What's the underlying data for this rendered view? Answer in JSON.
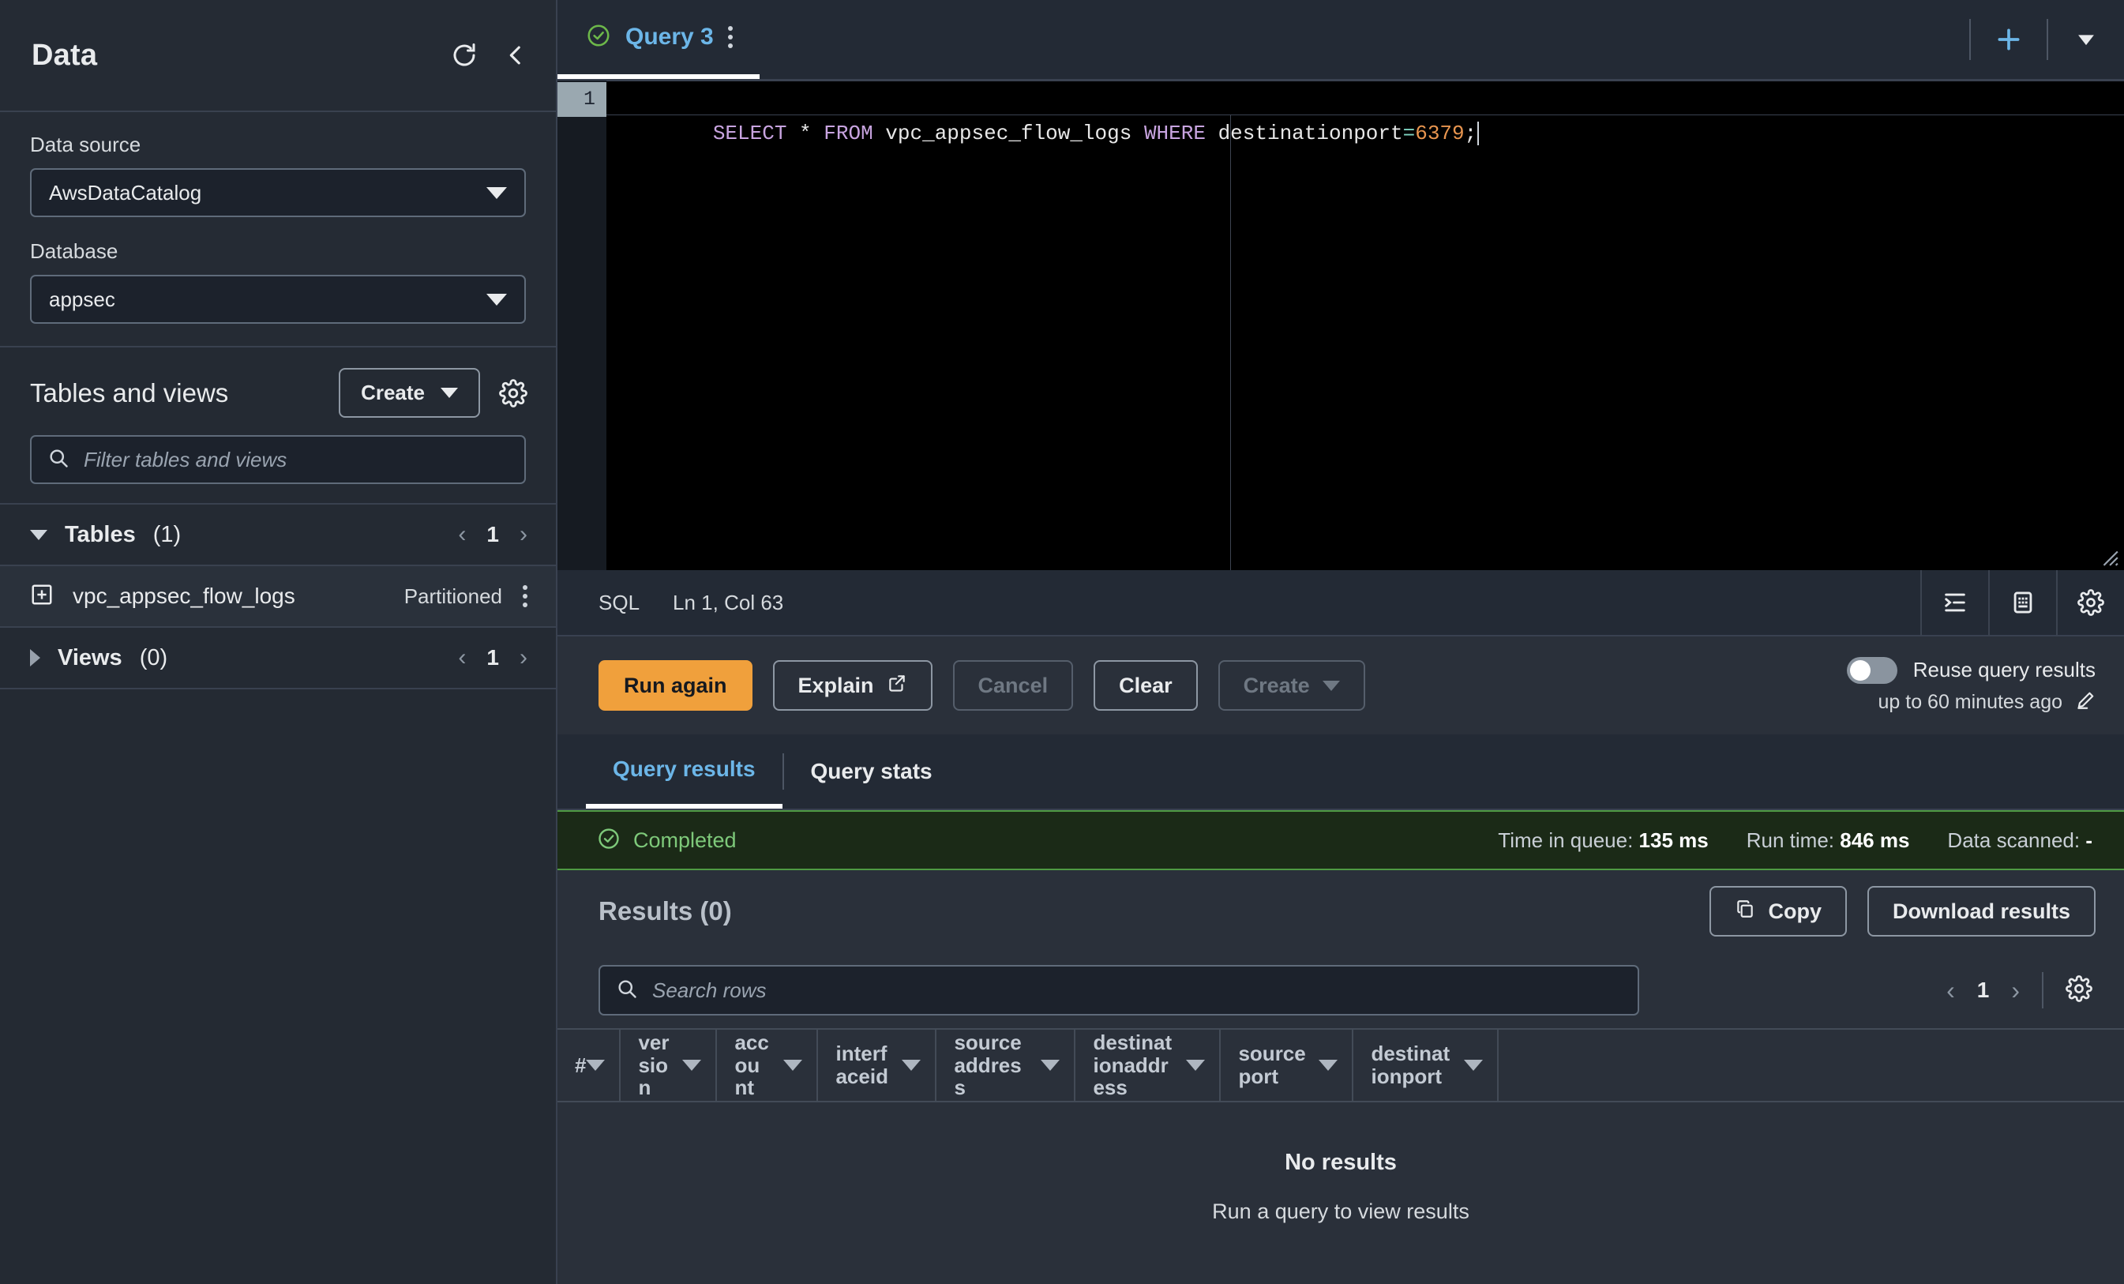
{
  "sidebar": {
    "title": "Data",
    "refresh_icon": "refresh-icon",
    "collapse_icon": "chevron-left-icon",
    "data_source_label": "Data source",
    "data_source_value": "AwsDataCatalog",
    "database_label": "Database",
    "database_value": "appsec",
    "tables_views_title": "Tables and views",
    "create_label": "Create",
    "settings_icon": "gear-icon",
    "filter_placeholder": "Filter tables and views",
    "groups": [
      {
        "name": "Tables",
        "count": "(1)",
        "page": "1",
        "expanded": true
      },
      {
        "name": "Views",
        "count": "(0)",
        "page": "1",
        "expanded": false
      }
    ],
    "table_item": {
      "name": "vpc_appsec_flow_logs",
      "badge": "Partitioned"
    }
  },
  "tabbar": {
    "tab_label": "Query 3",
    "status_icon": "check-circle-icon",
    "kebab_icon": "more-vertical-icon",
    "add_icon": "plus-icon",
    "dropdown_icon": "chevron-down-icon"
  },
  "editor": {
    "line_number": "1",
    "sql_tokens": [
      {
        "t": "SELECT",
        "c": "kw"
      },
      {
        "t": " * ",
        "c": "id"
      },
      {
        "t": "FROM",
        "c": "kw"
      },
      {
        "t": " vpc_appsec_flow_logs ",
        "c": "id"
      },
      {
        "t": "WHERE",
        "c": "kw"
      },
      {
        "t": " destinationport",
        "c": "id"
      },
      {
        "t": "=",
        "c": "op"
      },
      {
        "t": "6379",
        "c": "num"
      },
      {
        "t": ";",
        "c": "id"
      }
    ],
    "sql_text": "SELECT * FROM vpc_appsec_flow_logs WHERE destinationport=6379;"
  },
  "sqlbar": {
    "lang": "SQL",
    "cursor_pos": "Ln 1, Col 63",
    "format_icon": "format-indent-icon",
    "keyboard_icon": "keyboard-icon",
    "settings_icon": "gear-icon"
  },
  "actions": {
    "run_again": "Run again",
    "explain": "Explain",
    "explain_icon": "external-link-icon",
    "cancel": "Cancel",
    "clear": "Clear",
    "create": "Create",
    "reuse_label": "Reuse query results",
    "reuse_sub": "up to 60 minutes ago",
    "edit_icon": "pencil-icon",
    "reuse_on": false
  },
  "result_tabs": [
    {
      "label": "Query results",
      "active": true
    },
    {
      "label": "Query stats",
      "active": false
    }
  ],
  "status": {
    "icon": "check-circle-icon",
    "state": "Completed",
    "time_in_queue_label": "Time in queue:",
    "time_in_queue_value": "135 ms",
    "run_time_label": "Run time:",
    "run_time_value": "846 ms",
    "data_scanned_label": "Data scanned:",
    "data_scanned_value": "-"
  },
  "results": {
    "title": "Results",
    "count": "(0)",
    "copy_label": "Copy",
    "copy_icon": "copy-icon",
    "download_label": "Download results",
    "search_placeholder": "Search rows",
    "search_icon": "search-icon",
    "page": "1",
    "prev_icon": "chevron-left-icon",
    "next_icon": "chevron-right-icon",
    "settings_icon": "gear-icon",
    "columns": [
      {
        "label": "#",
        "width": 72
      },
      {
        "label": "version",
        "width": 122
      },
      {
        "label": "account",
        "width": 128
      },
      {
        "label": "interfaceid",
        "width": 150
      },
      {
        "label": "sourceaddress",
        "width": 176
      },
      {
        "label": "destinationaddress",
        "width": 184
      },
      {
        "label": "sourceport",
        "width": 168
      },
      {
        "label": "destinationport",
        "width": 184
      }
    ],
    "empty_title": "No results",
    "empty_subtitle": "Run a query to view results"
  },
  "colors": {
    "accent_orange": "#f0a03c",
    "link_blue": "#6cb6e8",
    "success_green": "#4f9a43",
    "panel": "#2a303a",
    "chrome": "#232a35"
  }
}
